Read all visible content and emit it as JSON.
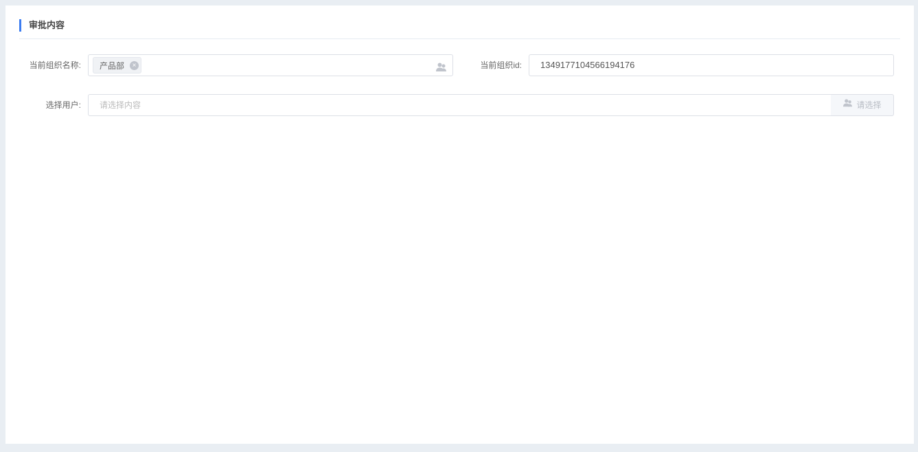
{
  "section": {
    "title": "审批内容"
  },
  "form": {
    "org_name": {
      "label": "当前组织名称:",
      "tags": [
        "产品部"
      ],
      "tag_close": "×"
    },
    "org_id": {
      "label": "当前组织id:",
      "value": "1349177104566194176"
    },
    "user": {
      "label": "选择用户:",
      "placeholder": "请选择内容",
      "button_label": "请选择"
    }
  },
  "colors": {
    "accent": "#3b7cf0",
    "background": "#e9eef3"
  }
}
